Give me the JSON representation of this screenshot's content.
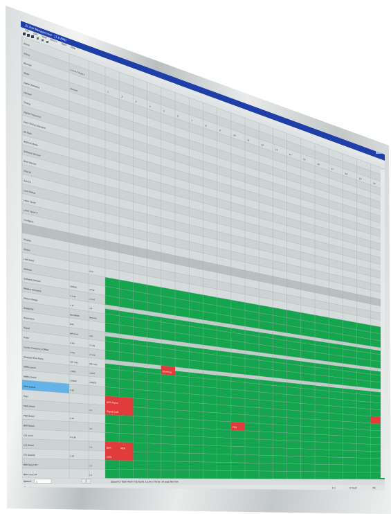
{
  "titlebar": {
    "title": "Dr.Tool   Management - [1.0  RMI]",
    "bg": "#1e3fa8"
  },
  "menubar": {
    "items": [
      "File",
      "Edit",
      "View",
      "Device",
      "Tools",
      "Help"
    ]
  },
  "left_rows": {
    "top": [
      "Name",
      "Group",
      "Number",
      "State",
      "Signal Standard",
      "Dataset",
      "Timing",
      "Digital Frequency",
      "Data Timing Standard",
      "Bit Rate",
      "Address Mode",
      "Software Version",
      "Boot Version",
      "Chip ID",
      "Sub Ch",
      "Lock Status",
      "Level Count",
      "Level Count 2",
      "Configure"
    ],
    "bottom": [
      "Display",
      "Status",
      "Line State",
      "Address",
      "Software Version",
      "Modem Firmware",
      "Detect Range",
      "Reliability",
      "Resolution",
      "Signal",
      "Pulse",
      "Center Frequency Offset",
      "Stepped Sine Pulse",
      "MPEG Level",
      "MPEG Detail",
      "MER Status",
      "Pass",
      "MER Detail",
      "PER Detail",
      "BER Detail",
      "CSI Level",
      "CSI Detail",
      "CSI Detail2",
      "BER Detail BT",
      "BER Lines BT"
    ]
  },
  "col2": {
    "State": "Standard",
    "Group": "1 Level  2  Target  3",
    "Line State": "Error"
  },
  "header_numbers": [
    "1",
    "2",
    "3",
    "4",
    "5",
    "6",
    "7",
    "8",
    "9",
    "10",
    "11",
    "12",
    "13",
    "14",
    "15",
    "16",
    "17",
    "18",
    "19",
    "20"
  ],
  "bottom_params": {
    "Software Version": [
      "CONDO",
      "S/T/W"
    ],
    "Modem Firmware": [
      "1.3.48",
      "2.3.47"
    ],
    "Detect Range": [
      "+ M",
      "2.4"
    ],
    "Reliability": [
      "BandWidth",
      "Network"
    ],
    "Resolution": [
      "MAP",
      ""
    ],
    "Signal": [
      "MPT-DVB",
      "STD"
    ],
    "Pulse": [
      "4 AM",
      "12 AM"
    ],
    "Center Frequency Offset": [
      "4 kHz",
      "12 kHz"
    ],
    "Stepped Sine Pulse": [
      "100 nsec",
      "800 nsec"
    ],
    "MPEG Level": [
      "-CDRO",
      "5.0OO"
    ],
    "MPEG Detail": [
      "CONDO",
      "CONDO"
    ],
    "MER Status": [
      "2 dB",
      ""
    ],
    "MER Detail": [
      "",
      "2.0"
    ],
    "PER Detail": [
      "1 dB",
      ""
    ],
    "BER Detail": [
      "",
      "3.0"
    ],
    "CSI Level": [
      "2.0 dB",
      ""
    ],
    "CSI Detail": [
      "",
      "2.0"
    ],
    "CSI Detail2": [
      "1 dB",
      ""
    ],
    "BER Detail BT": [
      "",
      "1.0"
    ],
    "BER Lines BT": [
      "",
      "1.0"
    ]
  },
  "alarm_labels": {
    "a1": "Warning",
    "a2": "BER Alarm",
    "a3": "Signal Lost",
    "a4": "PER",
    "a5": "BER",
    "a6": "MER",
    "a7": "LOW"
  },
  "statusbar": {
    "speed_label": "Speed",
    "speed_value": "1",
    "info": "Speed  LV   Total   Alarm      01/01/01 12:00      2 Tuner  33 type       Normal",
    "ready": "Ready",
    "right": [
      "0.1",
      "0 Fault",
      "OK"
    ]
  },
  "colors": {
    "grid_bg": "#d4d9d9",
    "green": "#15a54e",
    "alarm": "#e23b3b",
    "selected": "#63b3e8",
    "titlebar": "#1e3fa8"
  }
}
